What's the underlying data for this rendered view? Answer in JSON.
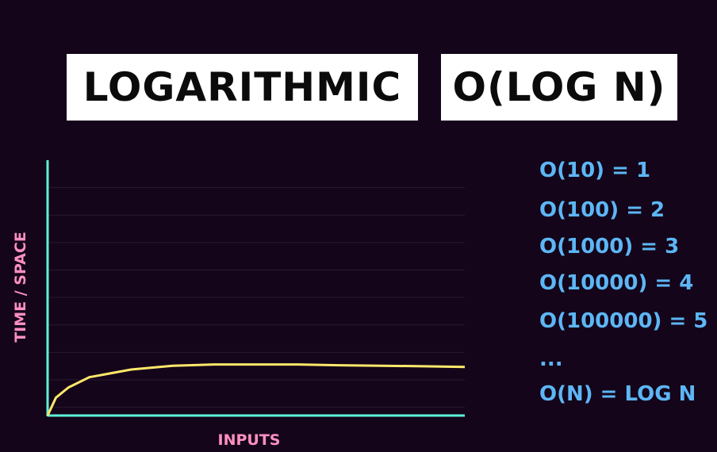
{
  "titles": {
    "left": "LOGARITHMIC",
    "right": "O(LOG N)"
  },
  "chart": {
    "ylabel": "TIME / SPACE",
    "xlabel": "INPUTS"
  },
  "formulas": [
    "O(10) = 1",
    "O(100) = 2",
    "O(1000) = 3",
    "O(10000) = 4",
    "O(100000) = 5",
    "...",
    "O(N) = LOG N"
  ],
  "colors": {
    "background": "#14051a",
    "title_box": "#ffffff",
    "axis": "#5ef2d8",
    "curve": "#ffe86a",
    "axis_label": "#ff8fc1",
    "formula_text": "#5db6f5",
    "gridline": "#2a1a2e"
  },
  "chart_data": {
    "type": "line",
    "title": "",
    "xlabel": "INPUTS",
    "ylabel": "TIME / SPACE",
    "grid": true,
    "series": [
      {
        "x": [
          0,
          0.02,
          0.05,
          0.1,
          0.2,
          0.3,
          0.4,
          0.5,
          0.6,
          0.7,
          0.8,
          0.9,
          1.0
        ],
        "values": [
          0,
          0.07,
          0.11,
          0.15,
          0.18,
          0.195,
          0.2,
          0.2,
          0.2,
          0.197,
          0.195,
          0.193,
          0.19
        ]
      }
    ],
    "xlim": [
      0,
      1
    ],
    "ylim": [
      0,
      1
    ]
  }
}
